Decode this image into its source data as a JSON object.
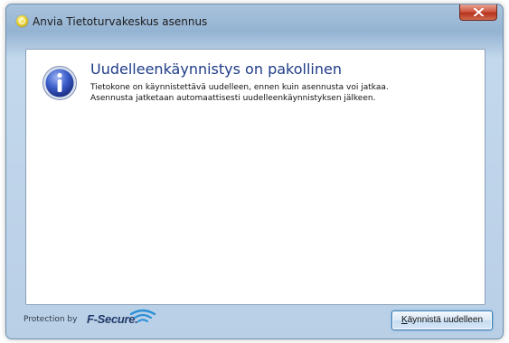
{
  "window": {
    "title": "Anvia Tietoturvakeskus asennus"
  },
  "message": {
    "heading": "Uudelleenkäynnistys on pakollinen",
    "line1": "Tietokone on käynnistettävä uudelleen, ennen kuin asennusta voi jatkaa.",
    "line2": "Asennusta jatketaan automaattisesti uudelleenkäynnistyksen jälkeen."
  },
  "footer": {
    "protection_label": "Protection by",
    "brand": "F-Secure.",
    "restart_button": {
      "access_key": "K",
      "rest": "äynnistä uudelleen"
    }
  },
  "icons": {
    "app": "shield-sun-icon",
    "info": "info-icon",
    "close": "close-icon",
    "brand": "f-secure-logo"
  },
  "colors": {
    "heading": "#1f3c87",
    "close_button": "#c7462f",
    "window_frame": "#a9c3dd"
  }
}
